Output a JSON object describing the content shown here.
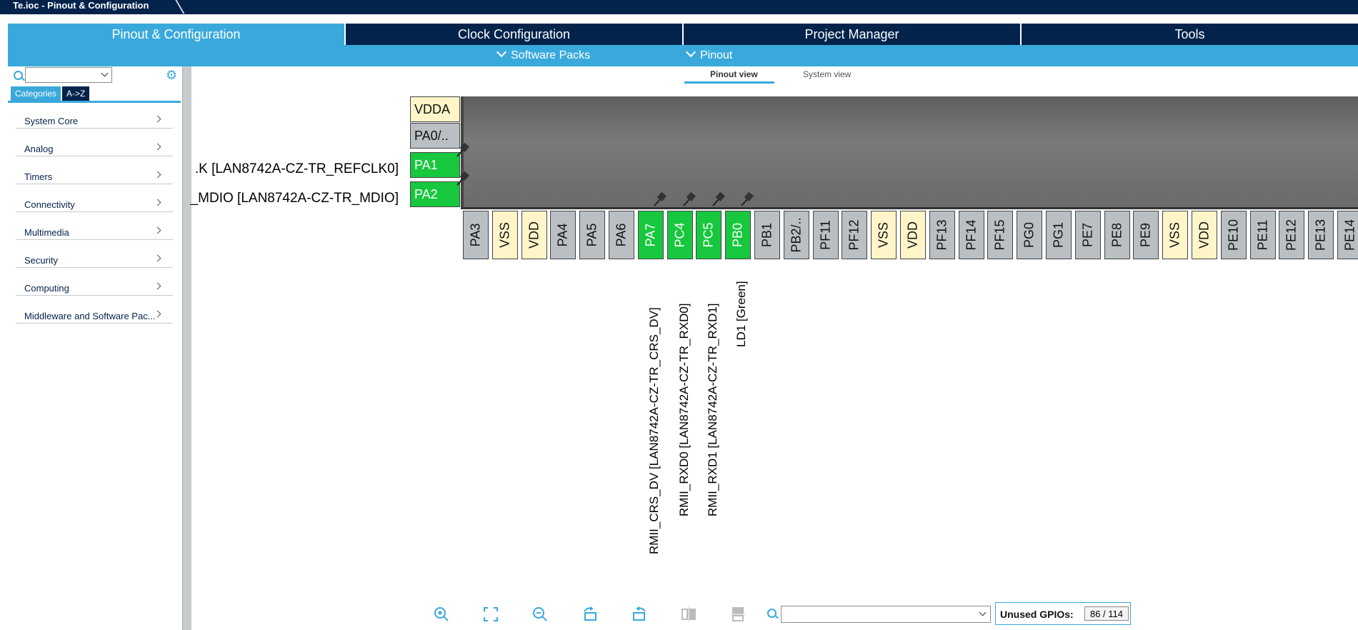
{
  "window": {
    "title": "Te.ioc - Pinout & Configuration"
  },
  "tabs": [
    "Pinout & Configuration",
    "Clock Configuration",
    "Project Manager",
    "Tools"
  ],
  "subbar": {
    "software_packs": "Software Packs",
    "pinout": "Pinout"
  },
  "left_panel": {
    "tabs": {
      "categories": "Categories",
      "az": "A->Z"
    },
    "categories": [
      "System Core",
      "Analog",
      "Timers",
      "Connectivity",
      "Multimedia",
      "Security",
      "Computing",
      "Middleware and Software Pac..."
    ]
  },
  "view_tabs": {
    "pinout_view": "Pinout view",
    "system_view": "System view"
  },
  "left_pins": [
    {
      "name": "VDDA",
      "type": "power"
    },
    {
      "name": "PA0/..",
      "type": "gpio"
    },
    {
      "name": "PA1",
      "type": "assigned"
    },
    {
      "name": "PA2",
      "type": "assigned"
    }
  ],
  "left_signals": [
    ".K [LAN8742A-CZ-TR_REFCLK0]",
    "_MDIO [LAN8742A-CZ-TR_MDIO]"
  ],
  "bottom_pins": [
    {
      "name": "PA3",
      "type": "gpio"
    },
    {
      "name": "VSS",
      "type": "power"
    },
    {
      "name": "VDD",
      "type": "power"
    },
    {
      "name": "PA4",
      "type": "gpio"
    },
    {
      "name": "PA5",
      "type": "gpio"
    },
    {
      "name": "PA6",
      "type": "gpio"
    },
    {
      "name": "PA7",
      "type": "assigned"
    },
    {
      "name": "PC4",
      "type": "assigned"
    },
    {
      "name": "PC5",
      "type": "assigned"
    },
    {
      "name": "PB0",
      "type": "assigned"
    },
    {
      "name": "PB1",
      "type": "gpio"
    },
    {
      "name": "PB2/..",
      "type": "gpio"
    },
    {
      "name": "PF11",
      "type": "gpio"
    },
    {
      "name": "PF12",
      "type": "gpio"
    },
    {
      "name": "VSS",
      "type": "power"
    },
    {
      "name": "VDD",
      "type": "power"
    },
    {
      "name": "PF13",
      "type": "gpio"
    },
    {
      "name": "PF14",
      "type": "gpio"
    },
    {
      "name": "PF15",
      "type": "gpio"
    },
    {
      "name": "PG0",
      "type": "gpio"
    },
    {
      "name": "PG1",
      "type": "gpio"
    },
    {
      "name": "PE7",
      "type": "gpio"
    },
    {
      "name": "PE8",
      "type": "gpio"
    },
    {
      "name": "PE9",
      "type": "gpio"
    },
    {
      "name": "VSS",
      "type": "power"
    },
    {
      "name": "VDD",
      "type": "power"
    },
    {
      "name": "PE10",
      "type": "gpio"
    },
    {
      "name": "PE11",
      "type": "gpio"
    },
    {
      "name": "PE12",
      "type": "gpio"
    },
    {
      "name": "PE13",
      "type": "gpio"
    },
    {
      "name": "PE14",
      "type": "gpio"
    }
  ],
  "bottom_signals": [
    "RMII_CRS_DV [LAN8742A-CZ-TR_CRS_DV]",
    "RMII_RXD0 [LAN8742A-CZ-TR_RXD0]",
    "RMII_RXD1 [LAN8742A-CZ-TR_RXD1]",
    "LD1 [Green]"
  ],
  "toolbar": {
    "icons": [
      "zoom-in-icon",
      "fit-screen-icon",
      "zoom-out-icon",
      "rotate-right-icon",
      "rotate-left-icon",
      "flip-vertical-icon",
      "flip-horizontal-icon"
    ],
    "unused_gpios_label": "Unused GPIOs:",
    "unused_gpios_value": "86 / 114"
  },
  "colors": {
    "navy": "#03234b",
    "accent": "#39a9dc",
    "assigned": "#17c73e",
    "power": "#fff5c8",
    "gpio": "#b9bfc3"
  }
}
